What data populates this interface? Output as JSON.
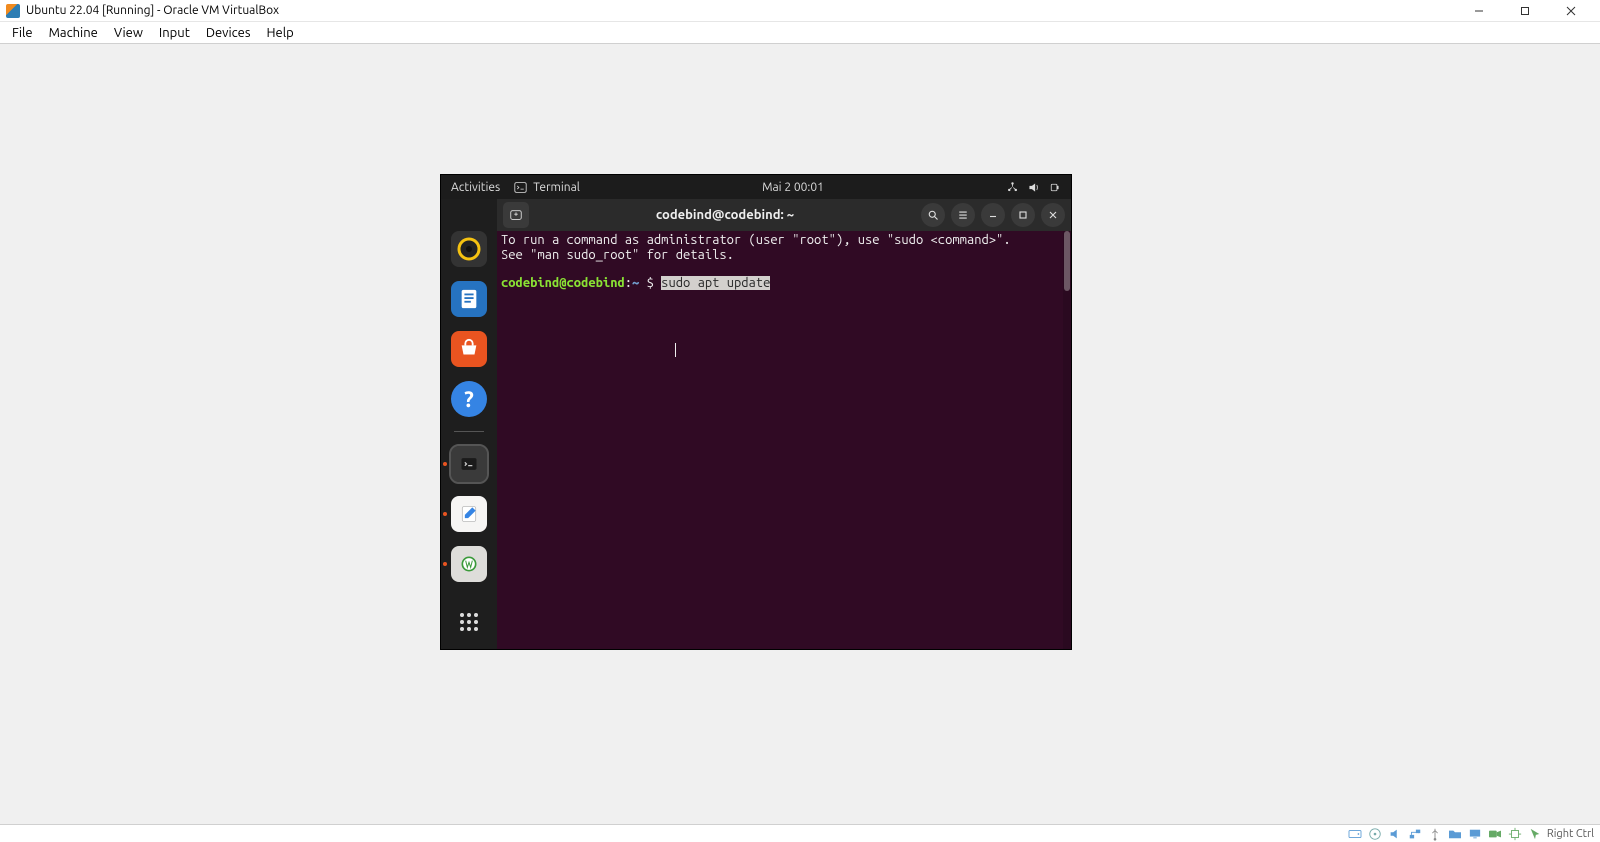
{
  "host": {
    "title": "Ubuntu 22.04 [Running] - Oracle VM VirtualBox",
    "menu": {
      "file": "File",
      "machine": "Machine",
      "view": "View",
      "input": "Input",
      "devices": "Devices",
      "help": "Help"
    },
    "status_key": "Right Ctrl"
  },
  "gnome": {
    "activities": "Activities",
    "app_name": "Terminal",
    "clock": "Mai 2  00:01"
  },
  "terminal": {
    "title": "codebind@codebind: ~",
    "motd_line1": "To run a command as administrator (user \"root\"), use \"sudo <command>\".",
    "motd_line2": "See \"man sudo_root\" for details.",
    "prompt_userhost": "codebind@codebind",
    "prompt_sep": ":",
    "prompt_path": "~",
    "prompt_sigil": "$",
    "command": "sudo apt update"
  },
  "dock": {
    "items": [
      "rhythmbox-icon",
      "libreoffice-writer-icon",
      "ubuntu-software-icon",
      "help-icon",
      "separator",
      "terminal-icon",
      "text-editor-icon",
      "trash-icon",
      "show-apps-icon"
    ]
  }
}
